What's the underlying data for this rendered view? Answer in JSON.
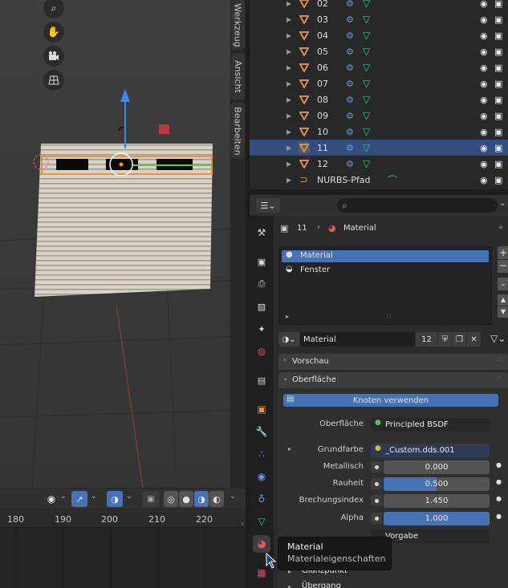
{
  "viewport": {
    "side_tabs": [
      "Werkzeug",
      "Ansicht",
      "Bearbeiten"
    ]
  },
  "timeline": {
    "frames": [
      "180",
      "190",
      "200",
      "210",
      "220"
    ]
  },
  "outliner": {
    "rows": [
      {
        "name": "02",
        "selected": false
      },
      {
        "name": "03",
        "selected": false
      },
      {
        "name": "04",
        "selected": false
      },
      {
        "name": "05",
        "selected": false
      },
      {
        "name": "06",
        "selected": false
      },
      {
        "name": "07",
        "selected": false
      },
      {
        "name": "08",
        "selected": false
      },
      {
        "name": "09",
        "selected": false
      },
      {
        "name": "10",
        "selected": false
      },
      {
        "name": "11",
        "selected": true
      },
      {
        "name": "12",
        "selected": false
      },
      {
        "name": "NURBS-Pfad",
        "selected": false
      }
    ]
  },
  "properties": {
    "breadcrumb_object": "11",
    "breadcrumb_section": "Material",
    "slots": [
      "Material",
      "Fenster"
    ],
    "material_name": "Material",
    "user_count": "12",
    "panel_preview": "Vorschau",
    "panel_surface": "Oberfläche",
    "use_nodes_button": "Knoten verwenden",
    "surface_label": "Oberfläche",
    "surface_value": "Principled BSDF",
    "base_color_label": "Grundfarbe",
    "base_color_value": "_Custom.dds.001",
    "metallic_label": "Metallisch",
    "metallic_value": "0.000",
    "roughness_label": "Rauheit",
    "roughness_value": "0.500",
    "ior_label": "Brechungsindex",
    "ior_value": "1.450",
    "alpha_label": "Alpha",
    "alpha_value": "1.000",
    "normal_value": "Vorgabe",
    "subpanel_specular": "Glanzpunkt",
    "subpanel_transition": "Übergang"
  },
  "tooltip": {
    "title": "Material",
    "subtitle": "Materialeigenschaften"
  },
  "colors": {
    "accent": "#4772b3",
    "selected_row": "#334d80",
    "object_orange": "#d78c5a",
    "mesh_green": "#38c289",
    "link_blue": "#6d9ae6"
  }
}
